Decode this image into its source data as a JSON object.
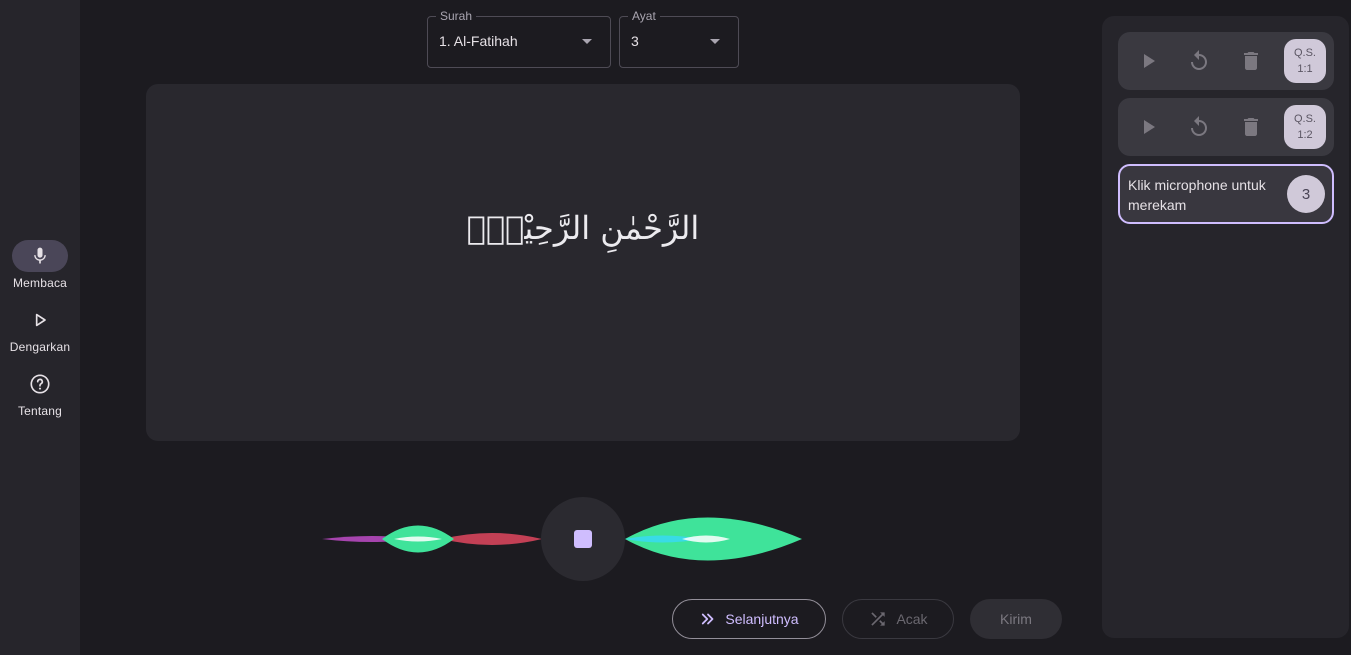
{
  "nav": {
    "items": [
      {
        "label": "Membaca",
        "icon": "microphone-icon",
        "active": true
      },
      {
        "label": "Dengarkan",
        "icon": "play-outline-icon",
        "active": false
      },
      {
        "label": "Tentang",
        "icon": "help-circle-icon",
        "active": false
      }
    ]
  },
  "selectors": {
    "surah": {
      "label": "Surah",
      "value": "1. Al-Fatihah"
    },
    "ayat": {
      "label": "Ayat",
      "value": "3"
    }
  },
  "ayah": {
    "text": "الرَّحْمٰنِ الرَّحِيْمِۙ"
  },
  "recorder": {
    "state": "recording",
    "stop_icon": "stop-icon"
  },
  "actions": {
    "next_label": "Selanjutnya",
    "random_label": "Acak",
    "send_label": "Kirim"
  },
  "recordings": {
    "items": [
      {
        "badge_line1": "Q.S.",
        "badge_line2": "1:1"
      },
      {
        "badge_line1": "Q.S.",
        "badge_line2": "1:2"
      }
    ],
    "prompt": {
      "text": "Klik microphone untuk merekam",
      "badge": "3"
    }
  },
  "colors": {
    "accent": "#cfbdfe",
    "background": "#1c1b20",
    "surface": "#29282e",
    "wave_green": "#3fe39a",
    "wave_pink": "#e0465f",
    "wave_cyan": "#39d9ee"
  }
}
